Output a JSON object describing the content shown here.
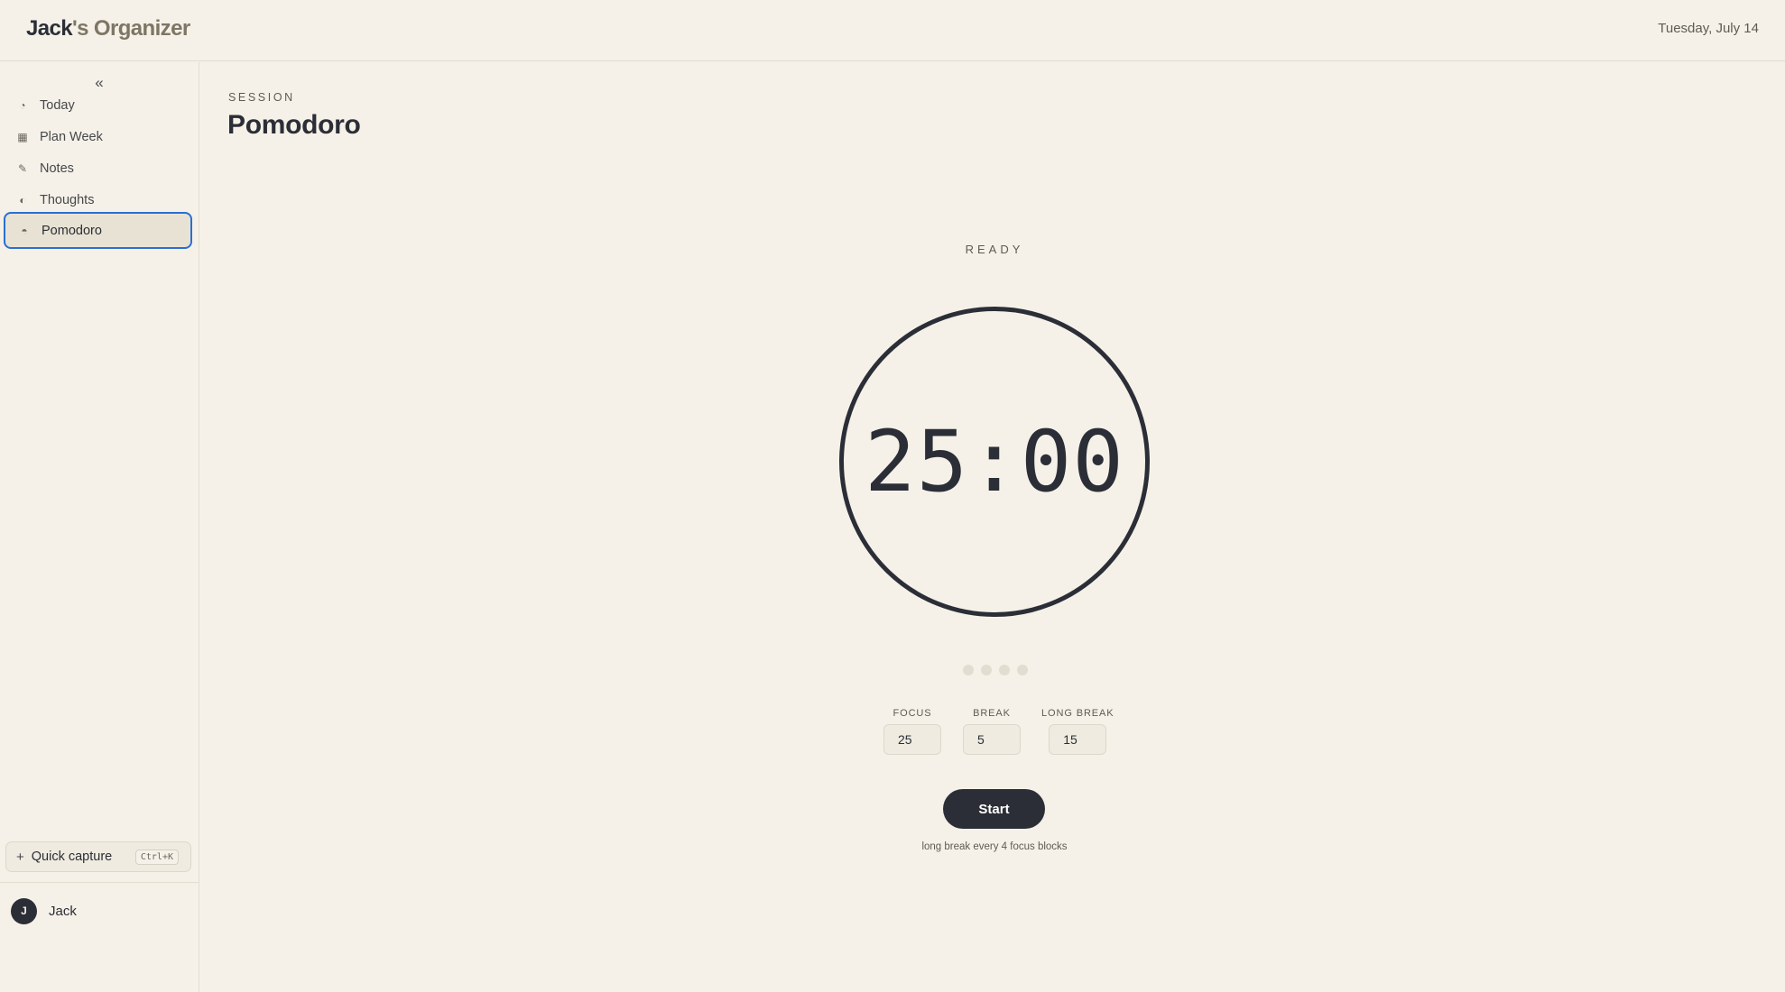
{
  "header": {
    "title_owner": "Jack",
    "title_rest": "'s Organizer",
    "date": "Tuesday, July 14"
  },
  "sidebar": {
    "collapse_glyph": "«",
    "items": [
      {
        "label": "Today",
        "icon": "clock-icon",
        "glyph": "◔"
      },
      {
        "label": "Plan Week",
        "icon": "grid-icon",
        "glyph": "▦"
      },
      {
        "label": "Notes",
        "icon": "pencil-icon",
        "glyph": "✎"
      },
      {
        "label": "Thoughts",
        "icon": "half-circle-icon",
        "glyph": "◐"
      },
      {
        "label": "Pomodoro",
        "icon": "tomato-icon",
        "glyph": "◓",
        "active": true
      }
    ],
    "quick_capture": {
      "plus": "+",
      "label": "Quick capture",
      "shortcut": "Ctrl+K"
    },
    "user": {
      "initial": "J",
      "name": "Jack"
    }
  },
  "main": {
    "eyebrow": "SESSION",
    "title": "Pomodoro",
    "status": "READY",
    "timer": "25:00",
    "progress_dots": {
      "total": 4,
      "completed": 0
    },
    "settings": {
      "focus": {
        "label": "FOCUS",
        "value": "25"
      },
      "break": {
        "label": "BREAK",
        "value": "5"
      },
      "long_break": {
        "label": "LONG BREAK",
        "value": "15"
      }
    },
    "start_label": "Start",
    "hint": "long break every 4 focus blocks"
  },
  "colors": {
    "background": "#f5f1e8",
    "ink": "#2b2e36",
    "accent_focus": "#2a6fd1",
    "title_muted": "#7d7664"
  }
}
